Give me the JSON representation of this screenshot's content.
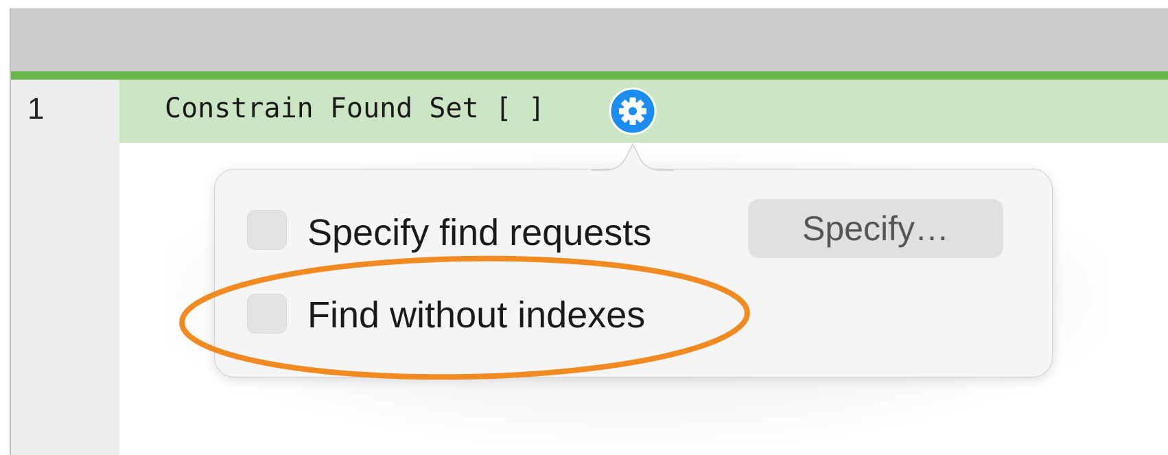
{
  "script_step": {
    "line_number": "1",
    "text": "Constrain Found Set [ ]"
  },
  "popover": {
    "options": [
      {
        "label": "Specify find requests",
        "checked": false
      },
      {
        "label": "Find without indexes",
        "checked": false
      }
    ],
    "specify_button_label": "Specify…"
  },
  "icons": {
    "step_options": "gear-icon"
  },
  "colors": {
    "toolbar": "#cccccc",
    "selected_row": "#cce5c4",
    "green_line": "#69b84b",
    "gear_blue": "#1b8cf2",
    "highlight": "#f28a22"
  }
}
